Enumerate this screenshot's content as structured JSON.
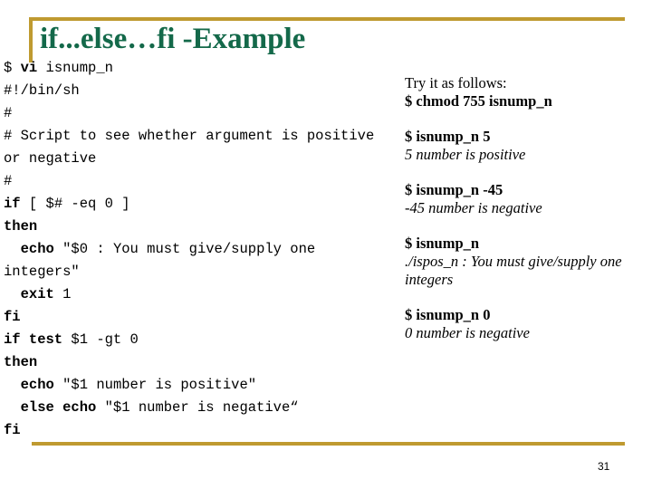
{
  "slide": {
    "title": "if...else…fi -Example",
    "page_number": "31",
    "accent_gold": "#BF9A30",
    "title_green": "#14694A"
  },
  "code": {
    "lines": [
      {
        "id": "l1",
        "pre": "$ ",
        "bold": "vi",
        "post": " isnump_n"
      },
      {
        "id": "l2",
        "pre": "#!/bin/sh",
        "bold": "",
        "post": ""
      },
      {
        "id": "l3",
        "pre": "#",
        "bold": "",
        "post": ""
      },
      {
        "id": "l4",
        "pre": "# Script to see whether argument is positive or negative",
        "bold": "",
        "post": ""
      },
      {
        "id": "l5",
        "pre": "#",
        "bold": "",
        "post": ""
      },
      {
        "id": "l6",
        "pre": "",
        "bold": "if",
        "post": " [ $# -eq 0 ]"
      },
      {
        "id": "l7",
        "pre": "",
        "bold": "then",
        "post": ""
      },
      {
        "id": "l8",
        "pre": "  ",
        "bold": "echo",
        "post": " \"$0 : You must give/supply one integers\""
      },
      {
        "id": "l9",
        "pre": "  ",
        "bold": "exit",
        "post": " 1"
      },
      {
        "id": "l10",
        "pre": "",
        "bold": "fi",
        "post": ""
      },
      {
        "id": "l11",
        "pre": "",
        "bold": "if test",
        "post": " $1 -gt 0"
      },
      {
        "id": "l12",
        "pre": "",
        "bold": "then",
        "post": ""
      },
      {
        "id": "l13",
        "pre": "  ",
        "bold": "echo",
        "post": " \"$1 number is positive\""
      },
      {
        "id": "l14",
        "pre": "  ",
        "bold": "else echo",
        "post": " \"$1 number is negative“"
      },
      {
        "id": "l15",
        "pre": "",
        "bold": "fi",
        "post": ""
      }
    ]
  },
  "outputs": {
    "groups": [
      {
        "intro": "Try it as follows:",
        "command": "$ chmod 755 isnump_n",
        "result": ""
      },
      {
        "intro": "",
        "command": "$ isnump_n 5",
        "result": "5 number is positive"
      },
      {
        "intro": "",
        "command": "$ isnump_n -45",
        "result": "-45 number is negative"
      },
      {
        "intro": "",
        "command": "$ isnump_n",
        "result": "./ispos_n : You must give/supply one integers"
      },
      {
        "intro": "",
        "command": "$ isnump_n 0",
        "result": "0 number is negative"
      }
    ]
  }
}
